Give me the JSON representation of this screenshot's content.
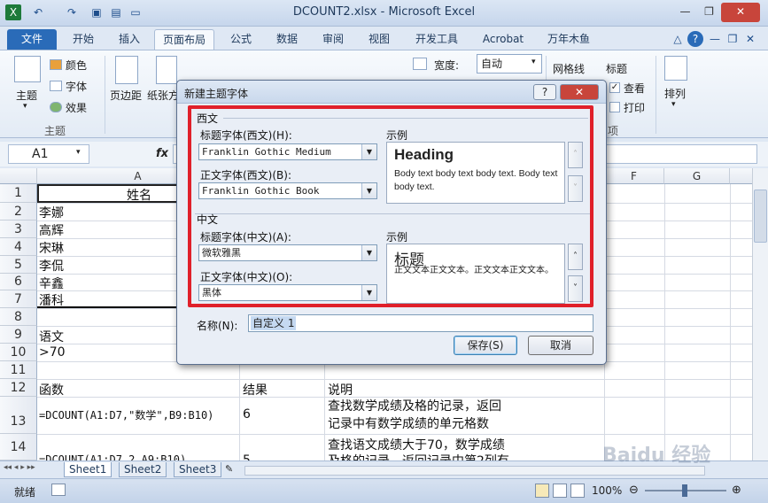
{
  "window": {
    "title": "DCOUNT2.xlsx - Microsoft Excel"
  },
  "tabs": [
    "文件",
    "开始",
    "插入",
    "页面布局",
    "公式",
    "数据",
    "审阅",
    "视图",
    "开发工具",
    "Acrobat",
    "万年木鱼"
  ],
  "ribbon": {
    "theme_group": "主题",
    "theme_btn": "主题",
    "colors": "颜色",
    "fonts": "字体",
    "effects": "效果",
    "margins": "页边距",
    "orientation": "纸张方",
    "width_label": "宽度:",
    "width_value": "自动",
    "gridlines": "网格线",
    "headings": "标题",
    "view": "查看",
    "print": "打印",
    "arrange": "排列",
    "sheet_options_suffix": "项"
  },
  "formula_bar": {
    "name_box": "A1",
    "fx": "fx"
  },
  "grid": {
    "columns": [
      "A",
      "F",
      "G"
    ],
    "rows": [
      "1",
      "2",
      "3",
      "4",
      "5",
      "6",
      "7",
      "8",
      "9",
      "10",
      "11",
      "12",
      "13",
      "14"
    ],
    "cells": {
      "a1": "姓名",
      "a2": "李娜",
      "a3": "高辉",
      "a4": "宋琳",
      "a5": "李侃",
      "a6": "辛鑫",
      "a7": "潘科",
      "a9": "语文",
      "a10": ">70",
      "a12": "函数",
      "b12": "结果",
      "c12": "说明",
      "a13": "=DCOUNT(A1:D7,\"数学\",B9:B10)",
      "b13": "6",
      "c13a": "查找数学成绩及格的记录，返回",
      "c13b": "记录中有数学成绩的单元格数",
      "a14": "=DCOUNT(A1:D7,2,A9:B10)",
      "b14": "5",
      "c14a": "查找语文成绩大于70，数学成绩",
      "c14b": "及格的记录，返回记录中第2列有"
    }
  },
  "sheets": [
    "Sheet1",
    "Sheet2",
    "Sheet3"
  ],
  "status": {
    "ready": "就绪",
    "zoom": "100%"
  },
  "dialog": {
    "title": "新建主题字体",
    "western": {
      "section": "西文",
      "heading_label": "标题字体(西文)(H):",
      "heading_value": "Franklin Gothic Medium",
      "body_label": "正文字体(西文)(B):",
      "body_value": "Franklin Gothic Book",
      "sample_label": "示例",
      "sample_heading": "Heading",
      "sample_body": "Body text body text body text. Body text body text."
    },
    "asian": {
      "section": "中文",
      "heading_label": "标题字体(中文)(A):",
      "heading_value": "微软雅黑",
      "body_label": "正文字体(中文)(O):",
      "body_value": "黑体",
      "sample_label": "示例",
      "sample_heading": "标题",
      "sample_body": "正文文本正文文本。正文文本正文文本。"
    },
    "name_label": "名称(N):",
    "name_value": "自定义 1",
    "save": "保存(S)",
    "cancel": "取消"
  },
  "watermark": "Baidu 经验"
}
